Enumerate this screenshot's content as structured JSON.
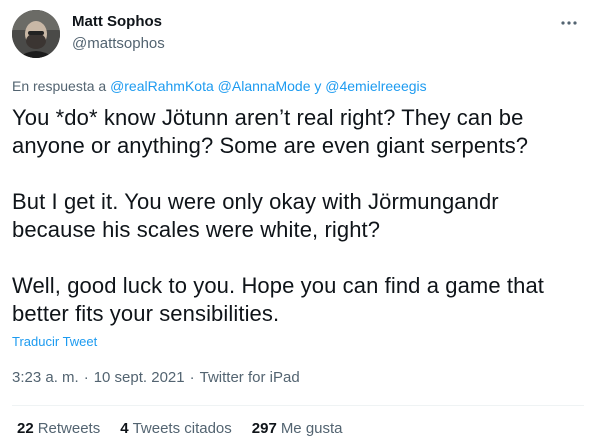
{
  "author": {
    "name": "Matt Sophos",
    "handle": "@mattsophos"
  },
  "reply": {
    "prefix": "En respuesta a",
    "mention_1": "@realRahmKota",
    "mention_2": "@AlannaMode",
    "connector": "y",
    "mention_3": "@4emielreeegis"
  },
  "tweet": {
    "paragraphs": [
      "You *do* know Jötunn aren’t real right? They can be anyone or anything? Some are even giant serpents?",
      "But I get it. You were only okay with Jörmungandr because his scales were white, right?",
      "Well, good luck to you. Hope you can find a game that better fits your sensibilities."
    ],
    "translate_label": "Traducir Tweet"
  },
  "meta": {
    "time": "3:23 a. m.",
    "separator": "·",
    "date": "10 sept. 2021",
    "source": "Twitter for iPad"
  },
  "stats": {
    "retweets_count": "22",
    "retweets_label": "Retweets",
    "quotes_count": "4",
    "quotes_label": "Tweets citados",
    "likes_count": "297",
    "likes_label": "Me gusta"
  },
  "icons": {
    "more": "more-options-icon"
  },
  "colors": {
    "accent": "#1d9bf0",
    "text": "#0f1419",
    "secondary": "#536471"
  }
}
